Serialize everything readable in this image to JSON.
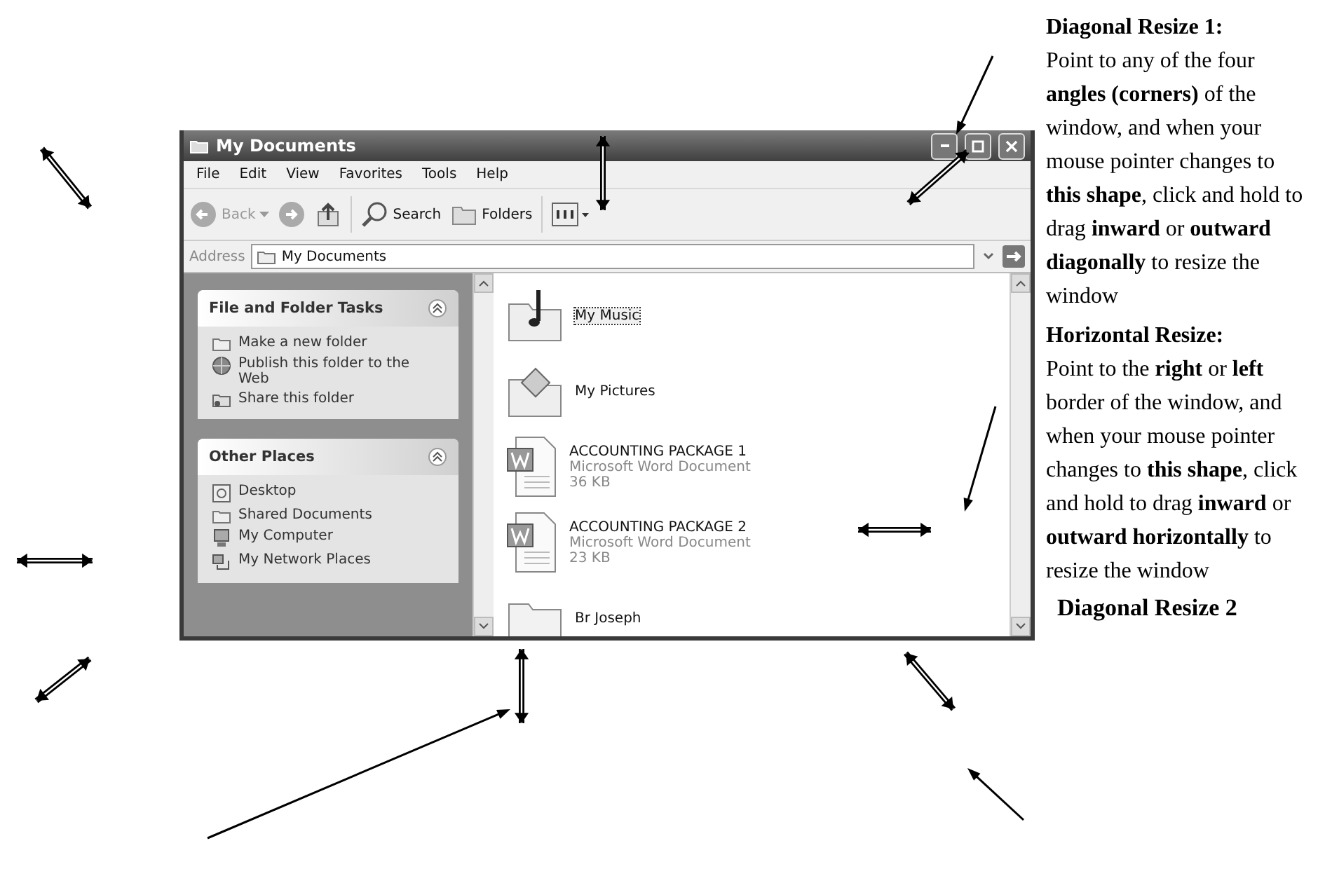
{
  "window": {
    "title": "My Documents",
    "menu": [
      "File",
      "Edit",
      "View",
      "Favorites",
      "Tools",
      "Help"
    ],
    "toolbar": [
      {
        "kind": "back",
        "label": "Back"
      },
      {
        "kind": "forward"
      },
      {
        "kind": "up"
      },
      {
        "kind": "search",
        "label": "Search"
      },
      {
        "kind": "folders",
        "label": "Folders"
      },
      {
        "kind": "views"
      }
    ],
    "address": {
      "label": "Address",
      "value": "My Documents"
    },
    "task_panels": [
      {
        "title": "File and Folder Tasks",
        "items": [
          {
            "kind": "folder",
            "label": "Make a new folder"
          },
          {
            "kind": "globe",
            "label": "Publish this folder to the Web"
          },
          {
            "kind": "share",
            "label": "Share this folder"
          }
        ]
      },
      {
        "title": "Other Places",
        "items": [
          {
            "kind": "desktop",
            "label": "Desktop"
          },
          {
            "kind": "folder",
            "label": "Shared Documents"
          },
          {
            "kind": "computer",
            "label": "My Computer"
          },
          {
            "kind": "network",
            "label": "My Network Places"
          }
        ]
      }
    ],
    "files": [
      {
        "kind": "music",
        "name": "My Music",
        "selected": true
      },
      {
        "kind": "pictures",
        "name": "My Pictures",
        "selected": false
      },
      {
        "kind": "word",
        "name": "ACCOUNTING PACKAGE 1",
        "type": "Microsoft Word Document",
        "size": "36 KB",
        "selected": false
      },
      {
        "kind": "word",
        "name": "ACCOUNTING PACKAGE 2",
        "type": "Microsoft Word Document",
        "size": "23 KB",
        "selected": false
      },
      {
        "kind": "folder",
        "name": "Br Joseph",
        "selected": false
      }
    ]
  },
  "notes": [
    {
      "heading": "Diagonal Resize 1:",
      "text": "Point to any of the four **angles (corners)** of the window, and when your mouse pointer changes to **this shape**, click and hold to drag **inward** or **outward diagonally** to resize the window"
    },
    {
      "heading": "Horizontal Resize:",
      "text": "Point to the **right** or **left** border of the window, and when your mouse pointer changes to **this shape**, click and hold to drag **inward** or **outward horizontally** to resize the window"
    }
  ],
  "caption": "Diagonal Resize 2"
}
